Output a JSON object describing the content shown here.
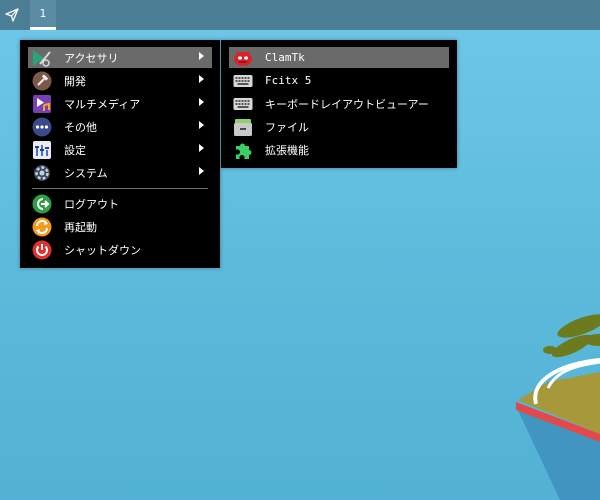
{
  "panel": {
    "launcher_icon": "paper-plane-icon",
    "workspace_label": "1"
  },
  "main_menu": {
    "items": [
      {
        "label": "アクセサリ",
        "icon": "accessories-icon",
        "submenu": true,
        "active": true
      },
      {
        "label": "開発",
        "icon": "development-icon",
        "submenu": true
      },
      {
        "label": "マルチメディア",
        "icon": "multimedia-icon",
        "submenu": true
      },
      {
        "label": "その他",
        "icon": "other-icon",
        "submenu": true
      },
      {
        "label": "設定",
        "icon": "settings-icon",
        "submenu": true
      },
      {
        "label": "システム",
        "icon": "system-icon",
        "submenu": true
      },
      {
        "label": "ログアウト",
        "icon": "logout-icon",
        "submenu": false
      },
      {
        "label": "再起動",
        "icon": "reboot-icon",
        "submenu": false
      },
      {
        "label": "シャットダウン",
        "icon": "shutdown-icon",
        "submenu": false
      }
    ]
  },
  "sub_menu": {
    "items": [
      {
        "label": "ClamTk",
        "icon": "clamtk-icon",
        "active": true
      },
      {
        "label": "Fcitx 5",
        "icon": "keyboard-icon"
      },
      {
        "label": "キーボードレイアウトビューアー",
        "icon": "keyboard-icon"
      },
      {
        "label": "ファイル",
        "icon": "file-cabinet-icon"
      },
      {
        "label": "拡張機能",
        "icon": "puzzle-piece-icon"
      }
    ]
  },
  "colors": {
    "panel": "#4c7f96",
    "menu_bg": "#000000",
    "menu_highlight": "#6a6a6a",
    "desktop": "#5cbadb"
  }
}
